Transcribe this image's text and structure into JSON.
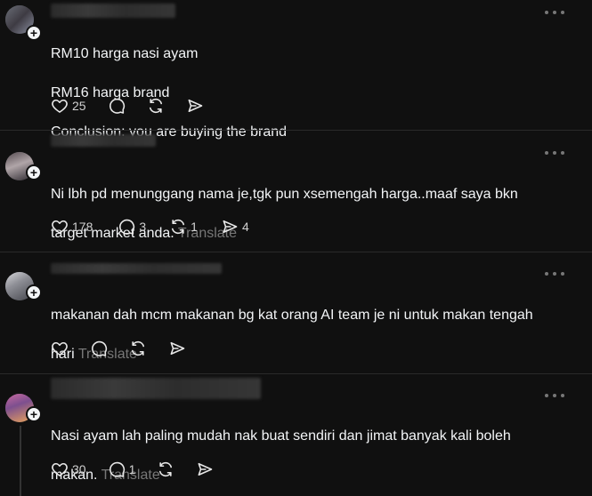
{
  "comments": [
    {
      "lines": [
        "RM10 harga nasi ayam",
        "RM16 harga brand",
        "Conclusion: you are buying the brand"
      ],
      "translate": "",
      "likes": "25",
      "replies": "",
      "reposts": "",
      "shares": ""
    },
    {
      "username_fragment": "iuuuzjjoviu  2u",
      "lines": [
        "Ni lbh pd menunggang nama je,tgk pun xsemengah harga..maaf saya bkn",
        "target market anda."
      ],
      "translate": "Translate",
      "likes": "178",
      "replies": "3",
      "reposts": "1",
      "shares": "4"
    },
    {
      "lines": [
        "makanan dah mcm makanan bg kat orang AI team je ni untuk makan tengah",
        "hari"
      ],
      "translate": "Translate",
      "likes": "",
      "replies": "",
      "reposts": "",
      "shares": ""
    },
    {
      "lines": [
        "Nasi ayam lah paling mudah nak buat sendiri dan jimat banyak kali boleh",
        "makan."
      ],
      "translate": "Translate",
      "likes": "30",
      "replies": "1",
      "reposts": "",
      "shares": ""
    }
  ],
  "icons": {
    "like": "heart-icon",
    "reply": "speech-bubble-icon",
    "repost": "repost-arrows-icon",
    "share": "send-icon",
    "more": "more-dots-icon",
    "follow": "plus-icon"
  },
  "colors": {
    "background": "#101010",
    "text": "#f3f5f7",
    "muted": "#777777"
  }
}
